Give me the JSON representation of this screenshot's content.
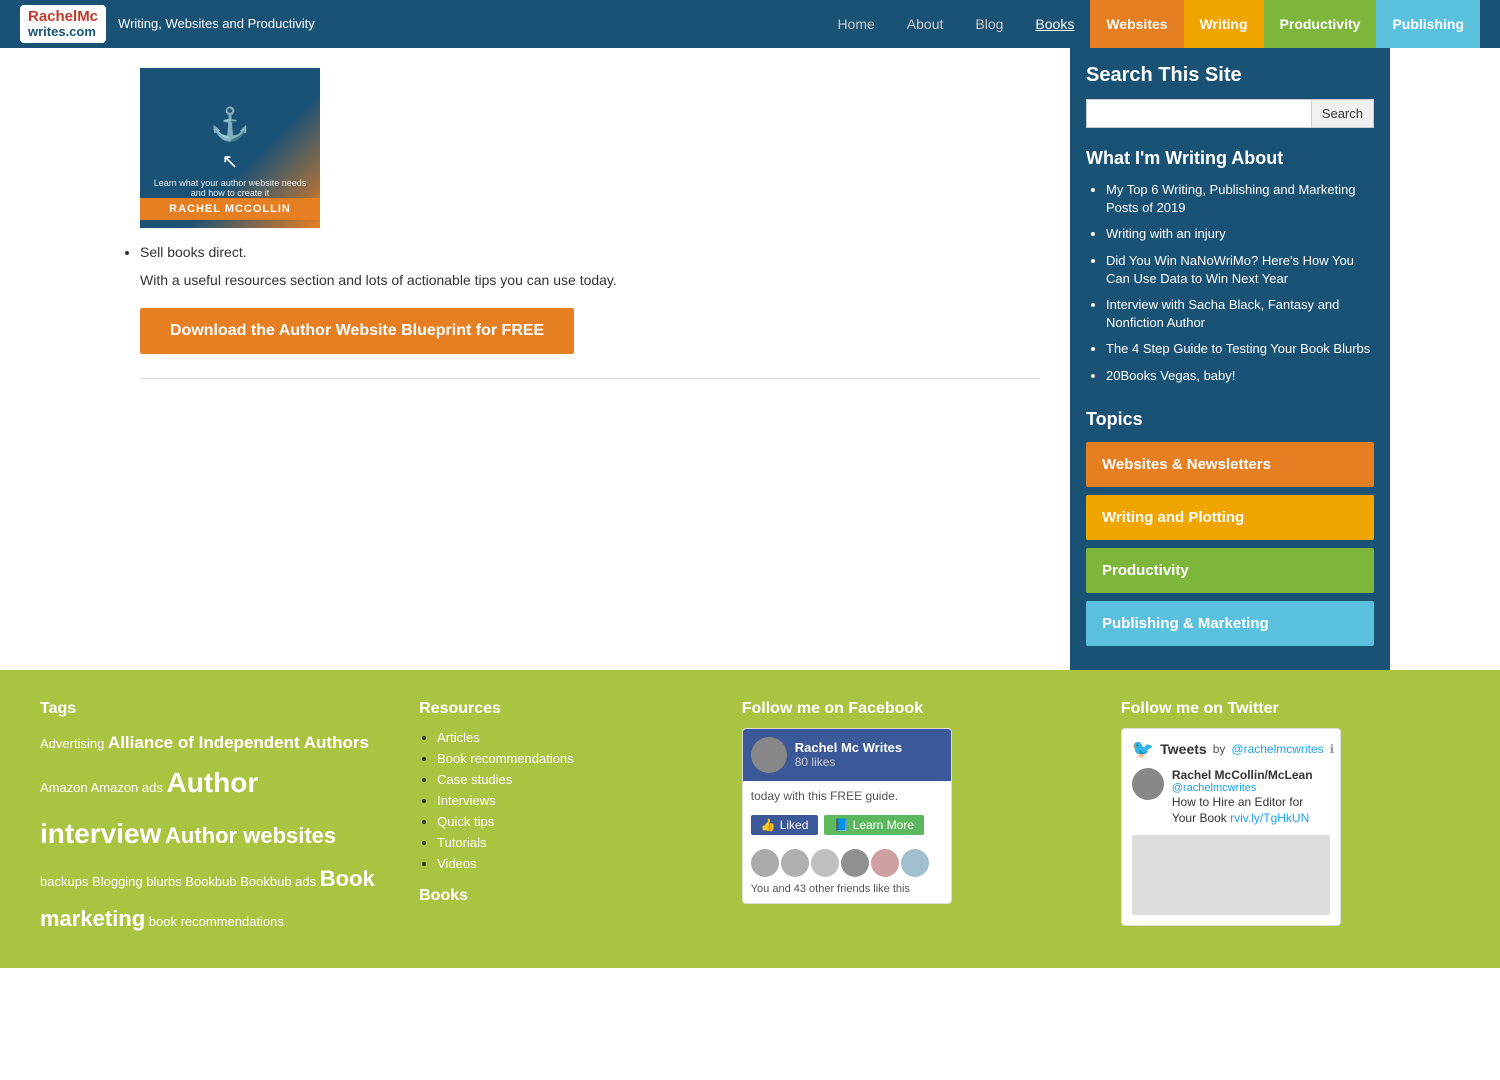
{
  "nav": {
    "logo_line1": "RachelMc",
    "logo_line2": "writes.com",
    "tagline": "Writing, Websites and Productivity",
    "links": [
      {
        "label": "Home",
        "id": "home"
      },
      {
        "label": "About",
        "id": "about"
      },
      {
        "label": "Blog",
        "id": "blog"
      },
      {
        "label": "Books",
        "id": "books",
        "active": true
      }
    ],
    "buttons": [
      {
        "label": "Websites",
        "id": "websites",
        "color": "orange"
      },
      {
        "label": "Writing",
        "id": "writing",
        "color": "yellow"
      },
      {
        "label": "Productivity",
        "id": "productivity",
        "color": "green"
      },
      {
        "label": "Publishing",
        "id": "publishing",
        "color": "blue"
      }
    ]
  },
  "main": {
    "sell_books_label": "Sell books direct.",
    "description": "With a useful resources section and lots of actionable tips you can use today.",
    "cta_label": "Download the Author Website Blueprint for FREE",
    "banner_small_text": "Learn what your author website needs and how to create it",
    "banner_author": "RACHEL MCCOLLIN"
  },
  "sidebar": {
    "search_section_title": "Search This Site",
    "search_placeholder": "",
    "search_button_label": "Search",
    "writing_about_title": "What I'm Writing About",
    "writing_about_items": [
      "My Top 6 Writing, Publishing and Marketing Posts of 2019",
      "Writing with an injury",
      "Did You Win NaNoWriMo? Here's How You Can Use Data to Win Next Year",
      "Interview with Sacha Black, Fantasy and Nonfiction Author",
      "The 4 Step Guide to Testing Your Book Blurbs",
      "20Books Vegas, baby!"
    ],
    "topics_title": "Topics",
    "topics": [
      {
        "label": "Websites & Newsletters",
        "color": "orange"
      },
      {
        "label": "Writing and Plotting",
        "color": "yellow"
      },
      {
        "label": "Productivity",
        "color": "green"
      },
      {
        "label": "Publishing & Marketing",
        "color": "blue"
      }
    ]
  },
  "footer": {
    "tags_title": "Tags",
    "tags": [
      {
        "text": "Advertising",
        "size": "small"
      },
      {
        "text": "Alliance of Independent Authors",
        "size": "medium"
      },
      {
        "text": "Amazon",
        "size": "small"
      },
      {
        "text": "Amazon ads",
        "size": "small"
      },
      {
        "text": "Author interview",
        "size": "xlarge"
      },
      {
        "text": "Author websites",
        "size": "large"
      },
      {
        "text": "backups",
        "size": "small"
      },
      {
        "text": "Blogging",
        "size": "small"
      },
      {
        "text": "blurbs",
        "size": "small"
      },
      {
        "text": "Bookbub",
        "size": "small"
      },
      {
        "text": "Bookbub ads",
        "size": "small"
      },
      {
        "text": "Book marketing",
        "size": "large"
      },
      {
        "text": "book recommendations",
        "size": "small"
      }
    ],
    "resources_title": "Resources",
    "resources_items": [
      "Articles",
      "Book recommendations",
      "Case studies",
      "Interviews",
      "Quick tips",
      "Tutorials",
      "Videos"
    ],
    "books_title": "Books",
    "facebook_title": "Follow me on Facebook",
    "facebook_page": "Rachel Mc Writes",
    "facebook_likes": "80 likes",
    "facebook_guide_text": "today with this FREE guide.",
    "facebook_friends_text": "You and 43 other friends like this",
    "twitter_title": "Follow me on Twitter",
    "tweets_label": "Tweets",
    "twitter_by": "by",
    "twitter_handle": "@rachelmcwrites",
    "tweet_author_name": "Rachel McCollin/McLean",
    "tweet_author_handle": "@rachelmcwrites",
    "tweet_text": "How to Hire an Editor for Your Book",
    "tweet_link": "rviv.ly/TgHkUN"
  }
}
